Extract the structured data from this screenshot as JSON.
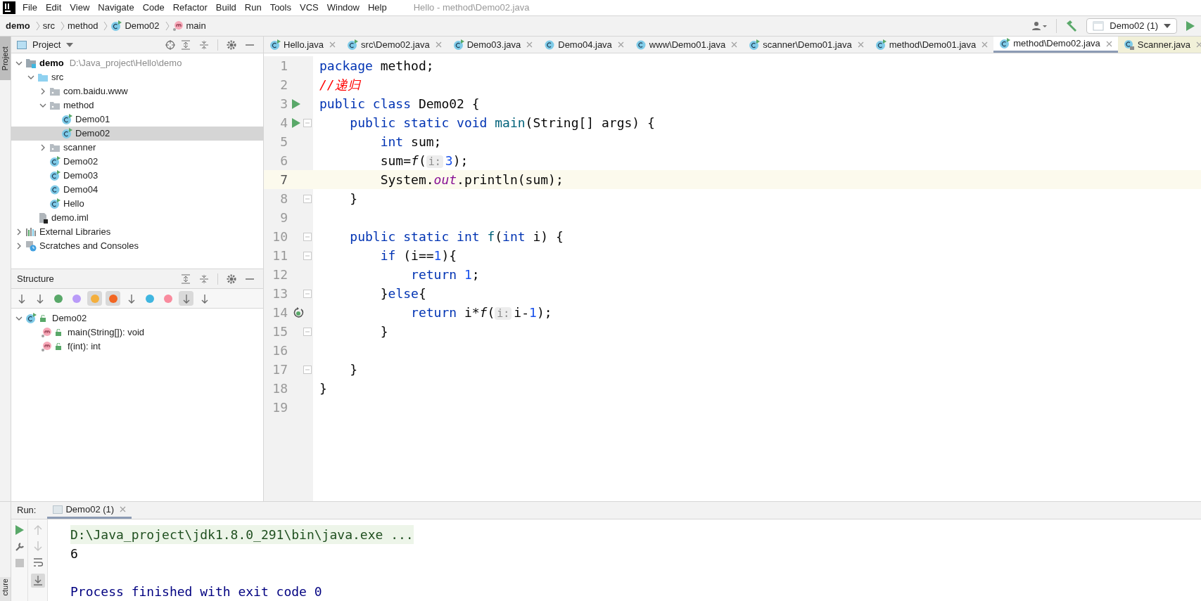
{
  "menu": [
    "File",
    "Edit",
    "View",
    "Navigate",
    "Code",
    "Refactor",
    "Build",
    "Run",
    "Tools",
    "VCS",
    "Window",
    "Help"
  ],
  "window": {
    "title": "Hello - method\\Demo02.java"
  },
  "breadcrumbs": [
    {
      "label": "demo",
      "kind": "module"
    },
    {
      "label": "src",
      "kind": "folder"
    },
    {
      "label": "method",
      "kind": "folder"
    },
    {
      "label": "Demo02",
      "kind": "class"
    },
    {
      "label": "main",
      "kind": "method"
    }
  ],
  "run_config": {
    "label": "Demo02 (1)"
  },
  "side_strip": {
    "top": "Project",
    "bottom": "cture"
  },
  "project": {
    "title": "Project",
    "tree": [
      {
        "label": "demo",
        "kind": "module",
        "path": "D:\\Java_project\\Hello\\demo",
        "expanded": true,
        "selected": false,
        "children": [
          {
            "label": "src",
            "kind": "source-folder",
            "expanded": true,
            "selected": false,
            "children": [
              {
                "label": "com.baidu.www",
                "kind": "package",
                "expanded": false,
                "selected": false
              },
              {
                "label": "method",
                "kind": "package",
                "expanded": true,
                "selected": false,
                "children": [
                  {
                    "label": "Demo01",
                    "kind": "runnable-class",
                    "selected": false
                  },
                  {
                    "label": "Demo02",
                    "kind": "runnable-class",
                    "selected": true
                  }
                ]
              },
              {
                "label": "scanner",
                "kind": "package",
                "expanded": false,
                "selected": false
              },
              {
                "label": "Demo02",
                "kind": "runnable-class",
                "selected": false
              },
              {
                "label": "Demo03",
                "kind": "runnable-class",
                "selected": false
              },
              {
                "label": "Demo04",
                "kind": "class",
                "selected": false
              },
              {
                "label": "Hello",
                "kind": "runnable-class",
                "selected": false
              }
            ]
          },
          {
            "label": "demo.iml",
            "kind": "file",
            "selected": false
          }
        ]
      },
      {
        "label": "External Libraries",
        "kind": "libraries",
        "expanded": false,
        "selected": false
      },
      {
        "label": "Scratches and Consoles",
        "kind": "scratches",
        "expanded": false,
        "selected": false
      }
    ]
  },
  "structure": {
    "title": "Structure",
    "toolbar": [
      {
        "kind": "sort-visibility",
        "on": false
      },
      {
        "kind": "sort-alpha",
        "on": false
      },
      {
        "kind": "inherited",
        "on": false
      },
      {
        "kind": "properties",
        "on": false
      },
      {
        "kind": "fields",
        "on": true
      },
      {
        "kind": "non-public",
        "on": true
      },
      {
        "kind": "lambdas-tree",
        "on": false
      },
      {
        "kind": "anonymous",
        "on": false
      },
      {
        "kind": "lambdas",
        "on": false
      },
      {
        "kind": "autoscroll-to",
        "on": true
      },
      {
        "kind": "autoscroll-from",
        "on": false
      }
    ],
    "tree": [
      {
        "label": "Demo02",
        "kind": "runnable-class",
        "expanded": true,
        "children": [
          {
            "label": "main(String[]): void",
            "kind": "method"
          },
          {
            "label": "f(int): int",
            "kind": "method"
          }
        ]
      }
    ]
  },
  "tabs": [
    {
      "label": "Hello.java",
      "kind": "runnable-class",
      "selected": false
    },
    {
      "label": "src\\Demo02.java",
      "kind": "runnable-class",
      "selected": false
    },
    {
      "label": "Demo03.java",
      "kind": "runnable-class",
      "selected": false
    },
    {
      "label": "Demo04.java",
      "kind": "class",
      "selected": false
    },
    {
      "label": "www\\Demo01.java",
      "kind": "class",
      "selected": false
    },
    {
      "label": "scanner\\Demo01.java",
      "kind": "runnable-class",
      "selected": false
    },
    {
      "label": "method\\Demo01.java",
      "kind": "runnable-class",
      "selected": false
    },
    {
      "label": "method\\Demo02.java",
      "kind": "runnable-class",
      "selected": true
    },
    {
      "label": "Scanner.java",
      "kind": "library",
      "selected": false
    }
  ],
  "code": [
    {
      "number": "1",
      "kind": "plain",
      "fold": false,
      "current": false,
      "tokens": [
        {
          "kind": "keyword",
          "text": "package"
        },
        {
          "kind": "plain",
          "text": " method;"
        }
      ]
    },
    {
      "number": "2",
      "kind": "plain",
      "fold": false,
      "current": false,
      "tokens": [
        {
          "kind": "comment",
          "text": "//递归"
        }
      ]
    },
    {
      "number": "3",
      "kind": "runnable",
      "fold": false,
      "current": false,
      "tokens": [
        {
          "kind": "keyword",
          "text": "public class"
        },
        {
          "kind": "plain",
          "text": " Demo02 {"
        }
      ]
    },
    {
      "number": "4",
      "kind": "runnable",
      "fold": true,
      "current": false,
      "tokens": [
        {
          "kind": "keyword",
          "text": "    public static void"
        },
        {
          "kind": "declaration",
          "text": " main"
        },
        {
          "kind": "plain",
          "text": "(String[] args) {"
        }
      ]
    },
    {
      "number": "5",
      "kind": "plain",
      "fold": false,
      "current": false,
      "tokens": [
        {
          "kind": "keyword",
          "text": "        int"
        },
        {
          "kind": "plain",
          "text": " sum;"
        }
      ]
    },
    {
      "number": "6",
      "kind": "plain",
      "fold": false,
      "current": false,
      "tokens": [
        {
          "kind": "plain",
          "text": "        sum="
        },
        {
          "kind": "italic",
          "text": "f"
        },
        {
          "kind": "plain",
          "text": "("
        },
        {
          "kind": "hint",
          "text": "i:"
        },
        {
          "kind": "number",
          "text": "3"
        },
        {
          "kind": "plain",
          "text": ");"
        }
      ]
    },
    {
      "number": "7",
      "kind": "plain",
      "fold": false,
      "current": true,
      "tokens": [
        {
          "kind": "plain",
          "text": "        System."
        },
        {
          "kind": "static-field",
          "text": "out"
        },
        {
          "kind": "plain",
          "text": ".println(sum);"
        }
      ]
    },
    {
      "number": "8",
      "kind": "plain",
      "fold": true,
      "current": false,
      "tokens": [
        {
          "kind": "plain",
          "text": "    }"
        }
      ]
    },
    {
      "number": "9",
      "kind": "plain",
      "fold": false,
      "current": false
    },
    {
      "number": "10",
      "kind": "plain",
      "fold": true,
      "current": false,
      "tokens": [
        {
          "kind": "keyword",
          "text": "    public static int"
        },
        {
          "kind": "declaration",
          "text": " f"
        },
        {
          "kind": "plain",
          "text": "("
        },
        {
          "kind": "keyword",
          "text": "int"
        },
        {
          "kind": "plain",
          "text": " i) {"
        }
      ]
    },
    {
      "number": "11",
      "kind": "plain",
      "fold": true,
      "current": false,
      "tokens": [
        {
          "kind": "keyword",
          "text": "        if"
        },
        {
          "kind": "plain",
          "text": " (i=="
        },
        {
          "kind": "number",
          "text": "1"
        },
        {
          "kind": "plain",
          "text": "){"
        }
      ]
    },
    {
      "number": "12",
      "kind": "plain",
      "fold": false,
      "current": false,
      "tokens": [
        {
          "kind": "keyword",
          "text": "            return"
        },
        {
          "kind": "number",
          "text": " 1"
        },
        {
          "kind": "plain",
          "text": ";"
        }
      ]
    },
    {
      "number": "13",
      "kind": "plain",
      "fold": true,
      "current": false,
      "tokens": [
        {
          "kind": "plain",
          "text": "        }"
        },
        {
          "kind": "keyword",
          "text": "else"
        },
        {
          "kind": "plain",
          "text": "{"
        }
      ]
    },
    {
      "number": "14",
      "kind": "recursive",
      "fold": false,
      "current": false,
      "tokens": [
        {
          "kind": "keyword",
          "text": "            return"
        },
        {
          "kind": "plain",
          "text": " i*"
        },
        {
          "kind": "italic",
          "text": "f"
        },
        {
          "kind": "plain",
          "text": "("
        },
        {
          "kind": "hint",
          "text": "i:"
        },
        {
          "kind": "plain",
          "text": "i-"
        },
        {
          "kind": "number",
          "text": "1"
        },
        {
          "kind": "plain",
          "text": ");"
        }
      ]
    },
    {
      "number": "15",
      "kind": "plain",
      "fold": true,
      "current": false,
      "tokens": [
        {
          "kind": "plain",
          "text": "        }"
        }
      ]
    },
    {
      "number": "16",
      "kind": "plain",
      "fold": false,
      "current": false
    },
    {
      "number": "17",
      "kind": "plain",
      "fold": true,
      "current": false,
      "tokens": [
        {
          "kind": "plain",
          "text": "    }"
        }
      ]
    },
    {
      "number": "18",
      "kind": "plain",
      "fold": false,
      "current": false,
      "tokens": [
        {
          "kind": "plain",
          "text": "}"
        }
      ]
    },
    {
      "number": "19",
      "kind": "plain",
      "fold": false,
      "current": false
    }
  ],
  "run": {
    "label": "Run:",
    "tab": "Demo02 (1)",
    "output": [
      {
        "kind": "command",
        "text": "D:\\Java_project\\jdk1.8.0_291\\bin\\java.exe ..."
      },
      {
        "kind": "output",
        "text": "6"
      },
      {
        "kind": "exit",
        "text": "Process finished with exit code 0"
      }
    ]
  }
}
